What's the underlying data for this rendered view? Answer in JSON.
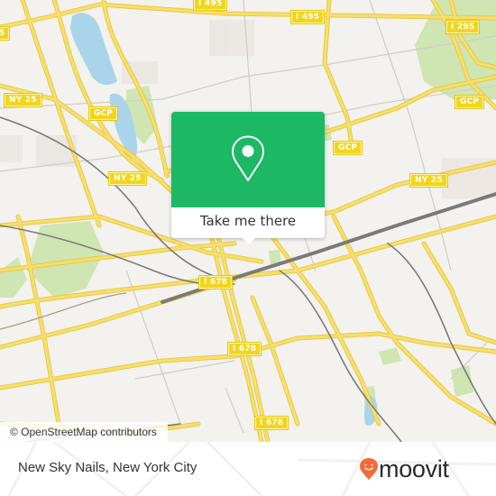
{
  "map": {
    "colors": {
      "background": "#f3f2ee",
      "highway": "#f7e06a",
      "highway_edge": "#e6c84a",
      "water": "#a9d4ea",
      "park": "#cfe5b2",
      "rail": "#7a7a7a",
      "minor_road": "#cfcdc8",
      "shield_fill": "#f2d51c"
    },
    "road_labels": [
      {
        "id": "i495-left",
        "text": "I 495"
      },
      {
        "id": "i495-right",
        "text": "I 495"
      },
      {
        "id": "i295",
        "text": "I 295"
      },
      {
        "id": "ny25-left-partial",
        "text": "5"
      },
      {
        "id": "ny25-west",
        "text": "NY 25"
      },
      {
        "id": "gcp-west",
        "text": "GCP"
      },
      {
        "id": "ny25-mid",
        "text": "NY 25"
      },
      {
        "id": "gcp-mid",
        "text": "GCP"
      },
      {
        "id": "gcp-east",
        "text": "GCP"
      },
      {
        "id": "ny25-east",
        "text": "NY 25"
      },
      {
        "id": "i678-north",
        "text": "I 678"
      },
      {
        "id": "i678-mid",
        "text": "I 678"
      },
      {
        "id": "i678-south",
        "text": "I 678"
      }
    ],
    "attribution": "© OpenStreetMap contributors"
  },
  "popup": {
    "icon": "map-pin-icon",
    "button_label": "Take me there",
    "color": "#1cb865"
  },
  "footer": {
    "place_name": "New Sky Nails, New York City",
    "brand": {
      "name": "moovit",
      "icon": "moovit-smiley-pin-icon",
      "color": "#f26b3a"
    }
  }
}
